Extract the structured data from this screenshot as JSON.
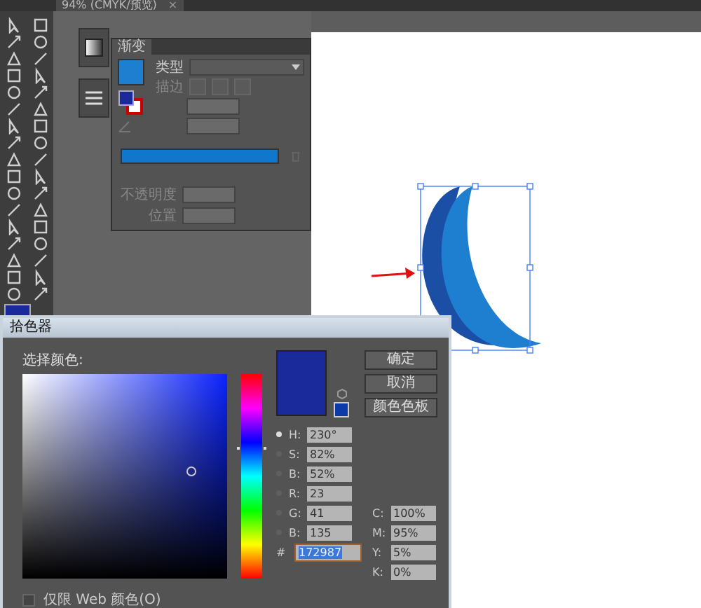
{
  "document_tab": {
    "title": "94% (CMYK/预览)",
    "close": "×"
  },
  "gradient_panel": {
    "title": "渐变",
    "type_label": "类型",
    "stroke_label": "描边",
    "opacity_label": "不透明度",
    "location_label": "位置"
  },
  "color_picker": {
    "title": "拾色器",
    "prompt": "选择颜色:",
    "hue": {
      "level": 0.64
    },
    "buttons": [
      "确定",
      "取消",
      "颜色色板"
    ],
    "fields": [
      {
        "label": "H:",
        "value": "230°",
        "selected": true
      },
      {
        "label": "S:",
        "value": "82%",
        "selected": false
      },
      {
        "label": "B:",
        "value": "52%",
        "selected": false
      },
      {
        "label": "R:",
        "value": "23",
        "selected": false
      },
      {
        "label": "G:",
        "value": "41",
        "selected": false
      },
      {
        "label": "B:",
        "value": "135",
        "selected": false
      }
    ],
    "hex": {
      "label": "#",
      "value": "172987"
    },
    "cmyk": [
      {
        "label": "C:",
        "value": "100%"
      },
      {
        "label": "M:",
        "value": "95%"
      },
      {
        "label": "Y:",
        "value": "5%"
      },
      {
        "label": "K:",
        "value": "0%"
      }
    ],
    "web_only": {
      "label": "仅限 Web 颜色(O)",
      "checked": false
    }
  }
}
